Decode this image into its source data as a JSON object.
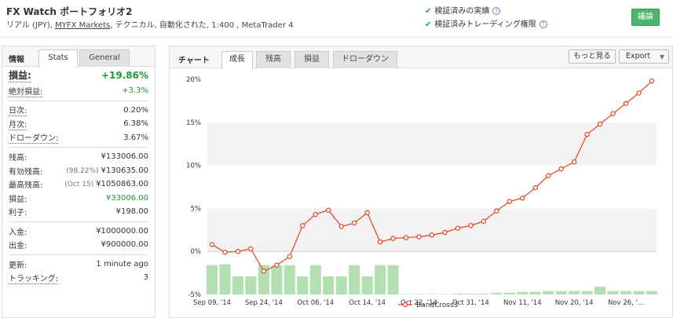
{
  "header": {
    "title": "FX Watch ポートフォリオ2",
    "subtitle_pre": "リアル (JPY), ",
    "subtitle_link": "MYFX Markets",
    "subtitle_post": ", テクニカル, 自動化された, 1:400 , MetaTrader 4",
    "verified_track": "検証済みの実績",
    "verified_trading": "検証済みトレーディング権限",
    "discuss_label": "議論"
  },
  "left": {
    "info_label": "情報",
    "tabs": [
      "Stats",
      "General"
    ],
    "gain_label": "損益:",
    "gain_value": "+19.86%",
    "abs_gain_label": "絶対損益:",
    "abs_gain_value": "+3.3%",
    "daily_label": "日次:",
    "daily_value": "0.20%",
    "monthly_label": "月次:",
    "monthly_value": "6.38%",
    "drawdown_label": "ドローダウン:",
    "drawdown_value": "3.67%",
    "balance_label": "残高:",
    "balance_value": "¥133006.00",
    "equity_label": "有効残高:",
    "equity_pct": "(98.22%)",
    "equity_value": "¥130635.00",
    "highest_label": "最高残高:",
    "highest_date": "(Oct 15)",
    "highest_value": "¥1050863.00",
    "profit_label": "損益:",
    "profit_value": "¥33006.00",
    "interest_label": "利子:",
    "interest_value": "¥198.00",
    "deposits_label": "入金:",
    "deposits_value": "¥1000000.00",
    "withdrawals_label": "出金:",
    "withdrawals_value": "¥900000.00",
    "updated_label": "更新:",
    "updated_value": "1 minute ago",
    "tracking_label": "トラッキング:",
    "tracking_value": "3"
  },
  "chart_panel": {
    "label": "チャート",
    "tabs": [
      "成長",
      "残高",
      "損益",
      "ドローダウン"
    ],
    "more_label": "もっと見る",
    "export_label": "Export"
  },
  "colors": {
    "line": "#e2431e",
    "bars": "#b4dfb0",
    "accent_green": "#1f9b3a"
  },
  "chart_data": {
    "type": "line",
    "ylim": [
      -5,
      20
    ],
    "yticks": [
      "-5%",
      "0%",
      "5%",
      "10%",
      "15%",
      "20%"
    ],
    "ytick_values": [
      -5,
      0,
      5,
      10,
      15,
      20
    ],
    "xticks": [
      "Sep 09, '14",
      "Sep 24, '14",
      "Oct 06, '14",
      "Oct 14, '14",
      "Oct 22, '14",
      "Oct 31, '14",
      "Nov 11, '14",
      "Nov 20, '14",
      "Nov 26, '..."
    ],
    "xtick_index": [
      0,
      4,
      8,
      12,
      16,
      20,
      24,
      28,
      32
    ],
    "series": [
      {
        "name": "BandCross3",
        "values": [
          0.8,
          -0.1,
          0.0,
          0.3,
          -2.3,
          -1.6,
          -0.6,
          3.0,
          4.3,
          4.8,
          2.9,
          3.3,
          4.5,
          1.1,
          1.5,
          1.6,
          1.7,
          1.9,
          2.2,
          2.7,
          3.0,
          3.5,
          4.7,
          5.8,
          6.2,
          7.4,
          8.8,
          9.6,
          10.4,
          13.6,
          14.8,
          16.0,
          17.2,
          18.4,
          19.8
        ]
      }
    ],
    "bars": [
      -1.6,
      -1.5,
      -2.9,
      -2.9,
      -1.6,
      -1.6,
      -1.6,
      -2.9,
      -1.6,
      -2.9,
      -2.9,
      -1.6,
      -2.9,
      -1.6,
      -1.6,
      -4.95,
      -4.95,
      -4.95,
      -4.95,
      -4.9,
      -4.9,
      -4.9,
      -4.8,
      -4.8,
      -4.7,
      -4.7,
      -4.6,
      -4.6,
      -4.6,
      -4.6,
      -4.1,
      -4.6,
      -4.6,
      -4.6,
      -4.6
    ]
  }
}
